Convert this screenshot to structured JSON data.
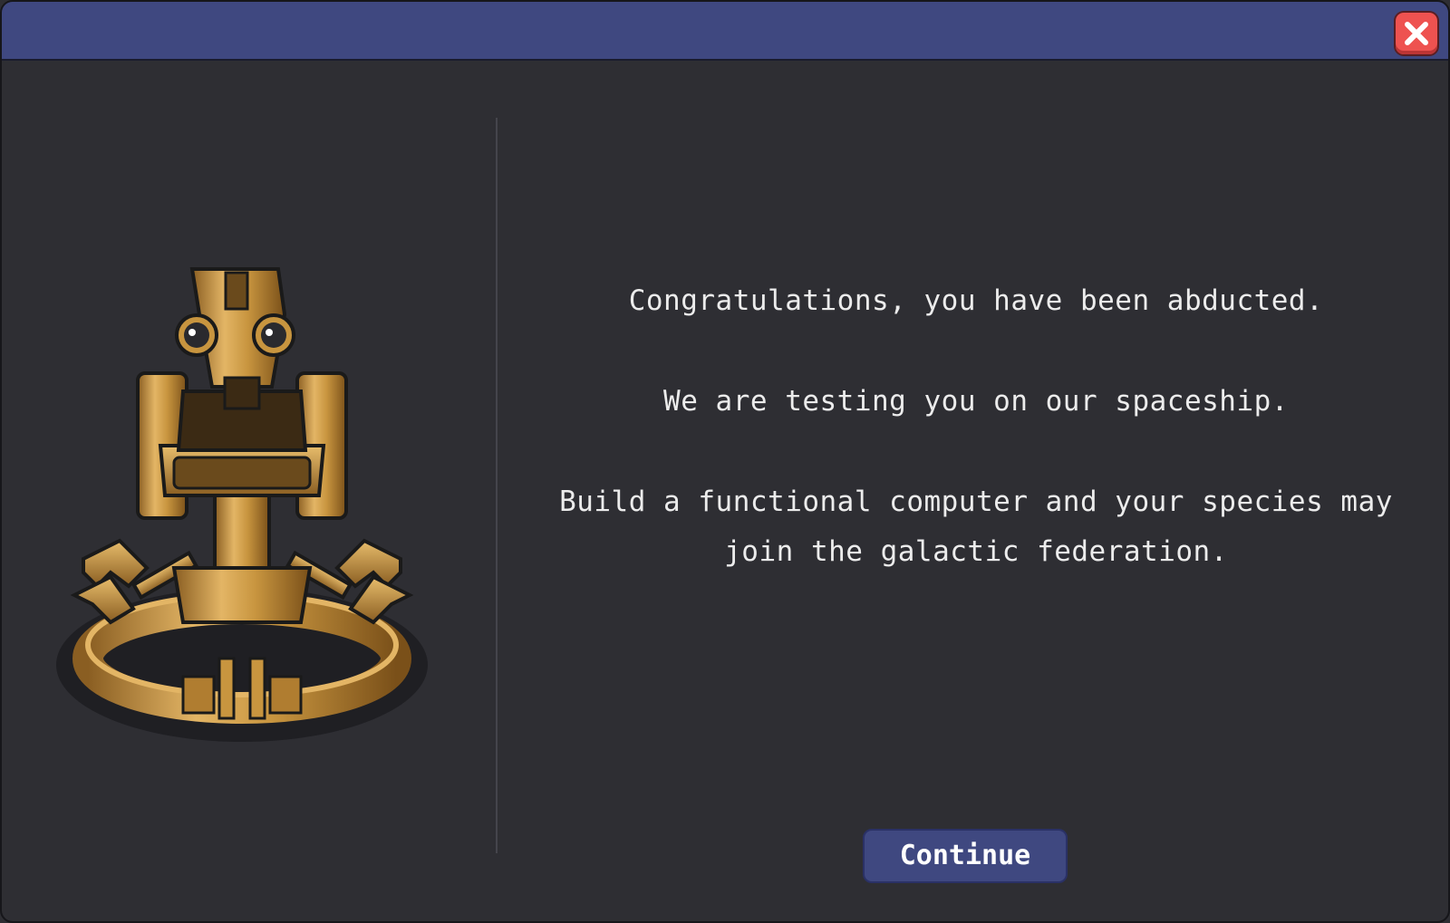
{
  "dialog": {
    "message_line_1": "Congratulations, you have been abducted.",
    "message_line_2": "We are testing you on our spaceship.",
    "message_line_3a": "Build a functional computer and your species may",
    "message_line_3b": "join the galactic federation.",
    "continue_label": "Continue"
  },
  "icons": {
    "close": "close-icon",
    "illustration": "robot-illustration"
  },
  "colors": {
    "titlebar": "#3f4880",
    "background": "#2e2e33",
    "close_button": "#ee5250",
    "button": "#3f4880",
    "robot_gold": "#c8953f"
  }
}
